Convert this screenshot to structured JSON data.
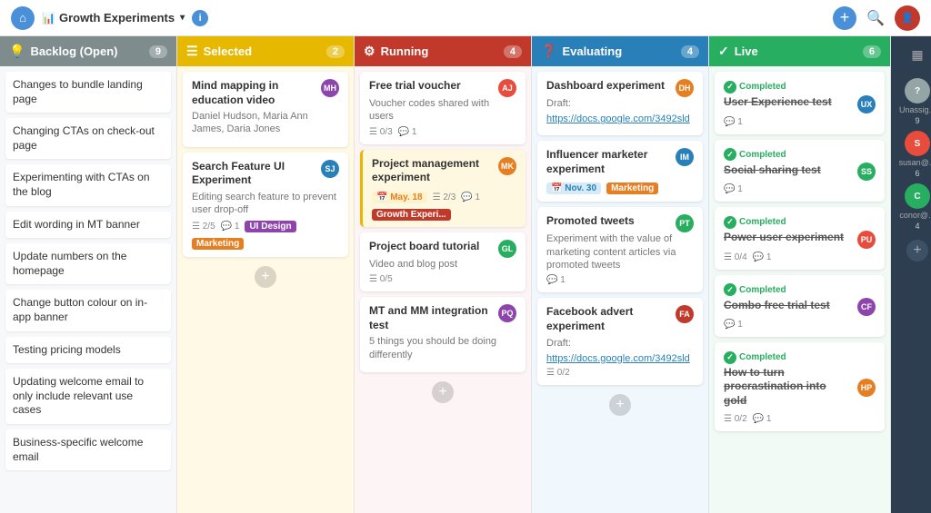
{
  "nav": {
    "home_label": "⌂",
    "project_name": "Growth Experiments",
    "info_label": "i",
    "add_label": "+",
    "search_label": "🔍",
    "chevron": "▾"
  },
  "columns": {
    "backlog": {
      "title": "Backlog (Open)",
      "count": 9,
      "color": "#7f8c8d",
      "items": [
        "Changes to bundle landing page",
        "Changing CTAs on check-out page",
        "Experimenting with CTAs on the blog",
        "Edit wording in MT banner",
        "Update numbers on the homepage",
        "Change button colour in-app banner",
        "Testing pricing models",
        "Updating welcome email to only include relevant use cases",
        "Business-specific welcome email"
      ]
    },
    "selected": {
      "title": "Selected",
      "count": 2,
      "cards": [
        {
          "title": "Mind mapping in education video",
          "people": "Daniel Hudson, Maria Ann James, Daria Jones",
          "avatar_color": "#8e44ad"
        },
        {
          "title": "Search Feature UI Experiment",
          "sub": "Editing search feature to prevent user drop-off",
          "progress": "2/5",
          "comments": 1,
          "tags": [
            "UI Design",
            "Marketing"
          ],
          "avatar_color": "#2980b9"
        }
      ]
    },
    "running": {
      "title": "Running",
      "count": 4,
      "cards": [
        {
          "title": "Free trial voucher",
          "sub": "Voucher codes shared with users",
          "progress": "0/3",
          "comments": 1,
          "avatar_color": "#e74c3c"
        },
        {
          "title": "Project management experiment",
          "date": "May. 18",
          "progress": "2/3",
          "comments": 1,
          "tag": "Growth Experi...",
          "avatar_color": "#e67e22",
          "highlight": true
        },
        {
          "title": "Project board tutorial",
          "sub": "Video and blog post",
          "progress": "0/5",
          "avatar_color": "#27ae60"
        },
        {
          "title": "MT and MM integration test",
          "sub": "5 things you should be doing differently",
          "avatar_color": "#8e44ad"
        }
      ]
    },
    "evaluating": {
      "title": "Evaluating",
      "count": 4,
      "cards": [
        {
          "title": "Dashboard experiment",
          "sub": "Draft:",
          "link": "https://docs.google.com/3492sld",
          "avatar_color": "#e67e22"
        },
        {
          "title": "Influencer marketer experiment",
          "date": "Nov. 30",
          "tag": "Marketing",
          "avatar_color": "#2980b9"
        },
        {
          "title": "Promoted tweets",
          "sub": "Experiment with the value of marketing content articles via promoted tweets",
          "comments": 1,
          "avatar_color": "#27ae60"
        },
        {
          "title": "Facebook advert experiment",
          "sub": "Draft:",
          "link": "https://docs.google.com/3492sld",
          "progress": "0/2",
          "avatar_color": "#c0392b"
        }
      ]
    },
    "live": {
      "title": "Live",
      "count": 6,
      "cards": [
        {
          "title": "User Experience test",
          "completed": true,
          "comments": 1,
          "avatar_color": "#2980b9"
        },
        {
          "title": "Social sharing test",
          "completed": true,
          "comments": 1,
          "avatar_color": "#27ae60"
        },
        {
          "title": "Power user experiment",
          "completed": true,
          "progress": "0/4",
          "comments": 1,
          "avatar_color": "#e74c3c"
        },
        {
          "title": "Combo free trial test",
          "completed": true,
          "comments": 1,
          "avatar_color": "#8e44ad"
        },
        {
          "title": "How to turn procrastination into gold",
          "completed": true,
          "progress": "0/2",
          "comments": 1,
          "avatar_color": "#e67e22"
        }
      ]
    }
  },
  "people": [
    {
      "label": "Unassig...",
      "count": 9,
      "color": "#95a5a6",
      "initials": "?"
    },
    {
      "label": "susan@...",
      "count": 6,
      "color": "#e74c3c",
      "initials": "S"
    },
    {
      "label": "conor@...",
      "count": 4,
      "color": "#27ae60",
      "initials": "C"
    }
  ]
}
